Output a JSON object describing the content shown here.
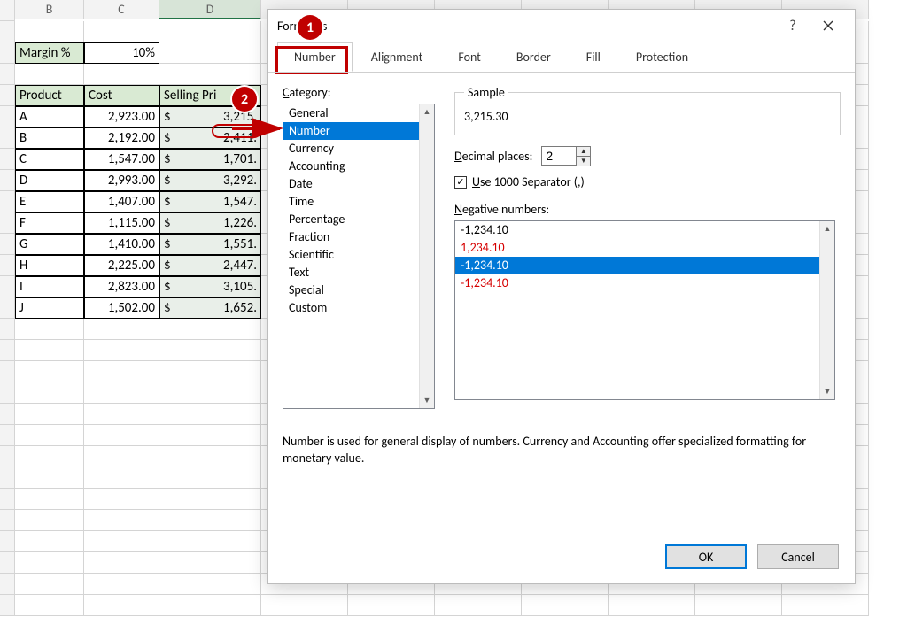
{
  "columns": {
    "b": "B",
    "c": "C",
    "d": "D"
  },
  "sheet": {
    "margin_label": "Margin %",
    "margin_value": "10%",
    "headers": {
      "product": "Product",
      "cost": "Cost",
      "selling": "Selling Pri"
    },
    "rows": [
      {
        "p": "A",
        "c": "2,923.00",
        "s": "3,215."
      },
      {
        "p": "B",
        "c": "2,192.00",
        "s": "2,411."
      },
      {
        "p": "C",
        "c": "1,547.00",
        "s": "1,701."
      },
      {
        "p": "D",
        "c": "2,993.00",
        "s": "3,292."
      },
      {
        "p": "E",
        "c": "1,407.00",
        "s": "1,547."
      },
      {
        "p": "F",
        "c": "1,115.00",
        "s": "1,226."
      },
      {
        "p": "G",
        "c": "1,410.00",
        "s": "1,551."
      },
      {
        "p": "H",
        "c": "2,225.00",
        "s": "2,447."
      },
      {
        "p": "I",
        "c": "2,823.00",
        "s": "3,105."
      },
      {
        "p": "J",
        "c": "1,502.00",
        "s": "1,652."
      }
    ]
  },
  "callouts": {
    "one": "1",
    "two": "2"
  },
  "dialog": {
    "title_full": "Format Cells",
    "title_prefix": "Forn",
    "title_suffix": "ells",
    "tabs": {
      "number": "Number",
      "alignment": "Alignment",
      "font": "Font",
      "border": "Border",
      "fill": "Fill",
      "protection": "Protection"
    },
    "category_label": "Category:",
    "category_underline": "C",
    "categories": [
      "General",
      "Number",
      "Currency",
      "Accounting",
      "Date",
      "Time",
      "Percentage",
      "Fraction",
      "Scientific",
      "Text",
      "Special",
      "Custom"
    ],
    "category_selected": "Number",
    "sample_label": "Sample",
    "sample_value": "3,215.30",
    "decimal_label": "Decimal places:",
    "decimal_underline": "D",
    "decimal_value": "2",
    "sep_label": "Use 1000 Separator (,)",
    "sep_underline": "U",
    "sep_checked": true,
    "neg_label": "Negative numbers:",
    "neg_underline": "N",
    "neg_items": [
      {
        "t": "-1,234.10",
        "cls": ""
      },
      {
        "t": "1,234.10",
        "cls": "red"
      },
      {
        "t": "-1,234.10",
        "cls": "sel"
      },
      {
        "t": "-1,234.10",
        "cls": "red"
      }
    ],
    "desc": "Number is used for general display of numbers.  Currency and Accounting offer specialized formatting for monetary value.",
    "ok": "OK",
    "cancel": "Cancel",
    "help": "?"
  }
}
